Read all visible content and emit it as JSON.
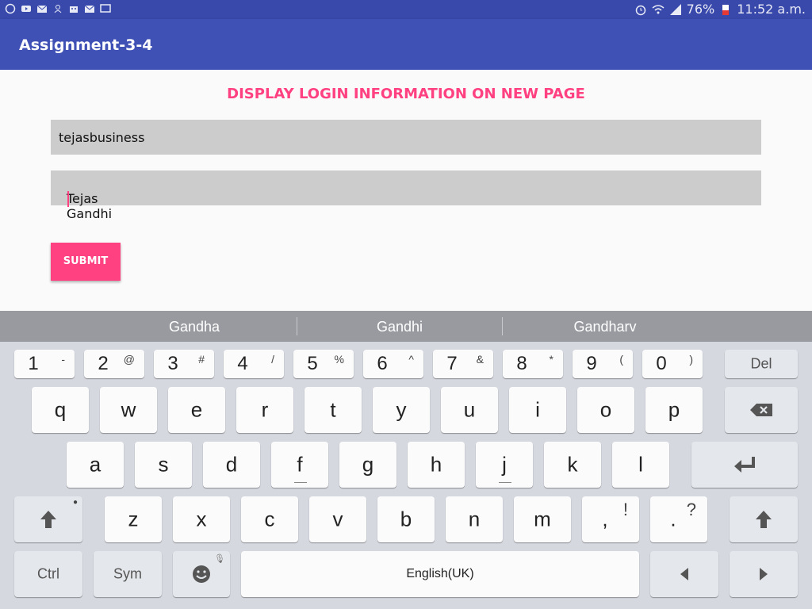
{
  "status_bar": {
    "left_icons": [
      "whatsapp-icon",
      "youtube-icon",
      "gmail-icon",
      "person-icon",
      "robot-icon",
      "email-icon",
      "cast-icon"
    ],
    "battery": "76%",
    "time": "11:52 a.m."
  },
  "toolbar": {
    "title": "Assignment-3-4"
  },
  "form": {
    "heading": "DISPLAY LOGIN INFORMATION ON NEW PAGE",
    "username_value": "tejasbusiness",
    "name_value": "Tejas Gandhi",
    "submit_label": "SUBMIT"
  },
  "suggestions": [
    "Gandha",
    "Gandhi",
    "Gandharv"
  ],
  "keyboard": {
    "number_row": [
      {
        "main": "1",
        "sup": "-"
      },
      {
        "main": "2",
        "sup": "@"
      },
      {
        "main": "3",
        "sup": "#"
      },
      {
        "main": "4",
        "sup": "/"
      },
      {
        "main": "5",
        "sup": "%"
      },
      {
        "main": "6",
        "sup": "^"
      },
      {
        "main": "7",
        "sup": "&"
      },
      {
        "main": "8",
        "sup": "*"
      },
      {
        "main": "9",
        "sup": "("
      },
      {
        "main": "0",
        "sup": ")"
      }
    ],
    "del_label": "Del",
    "row1": [
      "q",
      "w",
      "e",
      "r",
      "t",
      "y",
      "u",
      "i",
      "o",
      "p"
    ],
    "row2": [
      "a",
      "s",
      "d",
      "f",
      "g",
      "h",
      "j",
      "k",
      "l"
    ],
    "row3": [
      "z",
      "x",
      "c",
      "v",
      "b",
      "n",
      "m"
    ],
    "comma": {
      "main": ",",
      "sup": "!"
    },
    "period": {
      "main": ".",
      "sup": "?"
    },
    "ctrl_label": "Ctrl",
    "sym_label": "Sym",
    "space_label": "English(UK)",
    "colors": {
      "bg": "#d5d8de",
      "key": "#fbfbfc",
      "fn_key": "#e4e7eb"
    }
  },
  "colors": {
    "primary": "#3f51b5",
    "primary_dark": "#3949ab",
    "accent": "#ff4081"
  }
}
